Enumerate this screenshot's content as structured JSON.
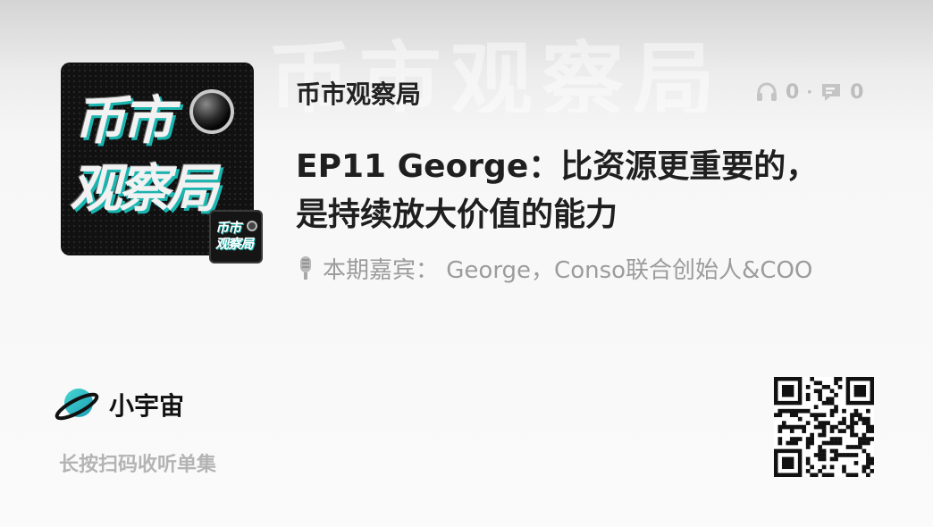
{
  "cover": {
    "line1": "币市",
    "line2": "观察局",
    "badge_line1": "币市",
    "badge_line2": "观察局"
  },
  "podcast": {
    "name": "币市观察局"
  },
  "stats": {
    "listen_count": "0",
    "comment_count": "0",
    "separator": "·"
  },
  "episode": {
    "title": "EP11 George：比资源更重要的，是持续放大价值的能力",
    "guest_line": "本期嘉宾： George，Conso联合创始人&COO"
  },
  "brand": {
    "name": "小宇宙",
    "accent": "#1bb5b0"
  },
  "hint": "长按扫码收听单集",
  "icons": {
    "listens": "headphones-icon",
    "comments": "comment-icon",
    "guest": "microphone-icon",
    "brand": "planet-logo-icon",
    "qr": "qr-code"
  }
}
